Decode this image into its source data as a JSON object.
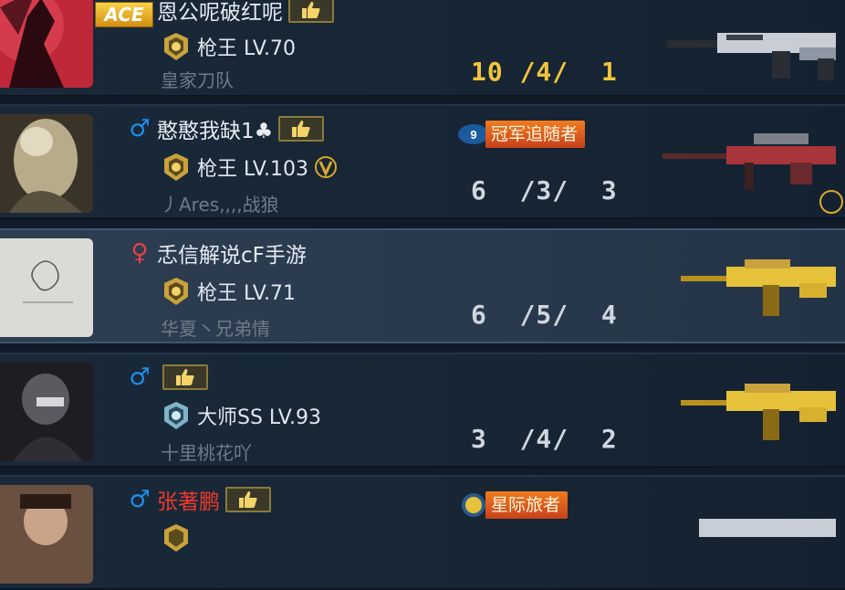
{
  "colors": {
    "gold_kda": "#f2c43c",
    "male": "#1e8ee8",
    "female": "#e2424a",
    "red_name": "#ef3a2c"
  },
  "players": [
    {
      "name": "恩公呢破红呢",
      "gender": "none",
      "ace": "ACE",
      "rank": "枪王 LV.70",
      "clan": "皇家刀队",
      "kda": "10 /4/  1",
      "title": null
    },
    {
      "name": "憨憨我缺1♣",
      "gender": "male",
      "ace": null,
      "rank": "枪王 LV.103",
      "clan": "丿Ares,,,,战狼",
      "kda": "6  /3/  3",
      "title": "冠军追随者"
    },
    {
      "name": "忎信解说cF手游",
      "gender": "female",
      "ace": null,
      "rank": "枪王 LV.71",
      "clan": "华夏丶兄弟情",
      "kda": "6  /5/  4",
      "title": null
    },
    {
      "name": "",
      "gender": "male",
      "ace": null,
      "rank": "大师SS LV.93",
      "clan": "十里桃花吖",
      "kda": "3  /4/  2",
      "title": null
    },
    {
      "name": "张著鹏",
      "gender": "male",
      "ace": null,
      "rank": "",
      "clan": "",
      "kda": "",
      "title": "星际旅者"
    }
  ]
}
